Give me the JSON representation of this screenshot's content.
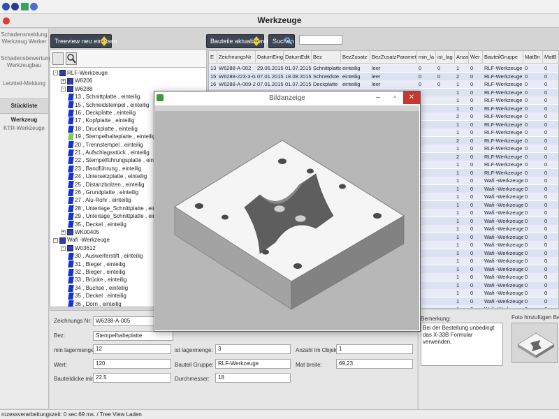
{
  "app": {
    "title": "Werkzeuge"
  },
  "nav": {
    "items": [
      {
        "label": "Schadensmeldung Werkzeug Werker",
        "active": false
      },
      {
        "label": "Schadensbewertung Werkzeugbau",
        "active": false
      },
      {
        "label": "Letztteil-Meldung",
        "active": false
      },
      {
        "label": "Stückliste Werkzeug",
        "active": true
      },
      {
        "label": "KTR-Werkzeuge",
        "active": false
      }
    ]
  },
  "toolbar": {
    "treeview_button": "Treeview neu einlesen",
    "update_parts_button": "Bauteile aktualisieren",
    "search_button": "Suchen",
    "search_value": ""
  },
  "tree": {
    "rows": [
      {
        "level": 0,
        "type": "folder",
        "toggle": "-",
        "label": "RLF-Werkzeuge"
      },
      {
        "level": 1,
        "type": "folder",
        "toggle": "+",
        "label": "W6206"
      },
      {
        "level": 1,
        "type": "folder",
        "toggle": "-",
        "label": "W6288"
      },
      {
        "level": 2,
        "type": "part",
        "label": "13 , Schnittplatte , einteilig"
      },
      {
        "level": 2,
        "type": "part",
        "label": "15 , Schneidstempel , einteilig"
      },
      {
        "level": 2,
        "type": "part",
        "label": "16 , Deckplatte , einteilig"
      },
      {
        "level": 2,
        "type": "part",
        "label": "17 , Kopfplatte , einteilig"
      },
      {
        "level": 2,
        "type": "part",
        "label": "18 , Druckplatte , einteilig"
      },
      {
        "level": 2,
        "type": "part-green",
        "label": "19 , Stempelhalteplatte , einteilig"
      },
      {
        "level": 2,
        "type": "part",
        "label": "20 , Trennstempel , einteilig"
      },
      {
        "level": 2,
        "type": "part",
        "label": "21 , Aufschlagsstück , einteilig"
      },
      {
        "level": 2,
        "type": "part",
        "label": "22 , Stempelführungsplatte , einteilig"
      },
      {
        "level": 2,
        "type": "part",
        "label": "23 , Bandführung , einteilig"
      },
      {
        "level": 2,
        "type": "part",
        "label": "24 , Untersetzplatte , einteilig"
      },
      {
        "level": 2,
        "type": "part",
        "label": "25 , Distanzbolzen , einteilig"
      },
      {
        "level": 2,
        "type": "part",
        "label": "26 , Grundplatte , einteilig"
      },
      {
        "level": 2,
        "type": "part",
        "label": "27 , Alu-Rohr , einteilig"
      },
      {
        "level": 2,
        "type": "part",
        "label": "28 , Unterlage_Schnittplatte , einteilig"
      },
      {
        "level": 2,
        "type": "part",
        "label": "29 , Unterlage_Schnittplatte , einteilig"
      },
      {
        "level": 2,
        "type": "part",
        "label": "35 , Deckel , einteilig"
      },
      {
        "level": 1,
        "type": "folder",
        "toggle": "+",
        "label": "WK00405"
      },
      {
        "level": 0,
        "type": "folder",
        "toggle": "-",
        "label": "Wafi -Werkzeuge"
      },
      {
        "level": 1,
        "type": "folder",
        "toggle": "-",
        "label": "W03612"
      },
      {
        "level": 2,
        "type": "part",
        "label": "30 , Auswerferstift , einteilig"
      },
      {
        "level": 2,
        "type": "part",
        "label": "31 , Bieger , einteilig"
      },
      {
        "level": 2,
        "type": "part",
        "label": "32 , Bieger , einteilig"
      },
      {
        "level": 2,
        "type": "part",
        "label": "33 , Brücke , einteilig"
      },
      {
        "level": 2,
        "type": "part",
        "label": "34 , Buchse , einteilig"
      },
      {
        "level": 2,
        "type": "part",
        "label": "35 , Deckel , einteilig"
      },
      {
        "level": 2,
        "type": "part",
        "label": "36 , Dorn , einteilig"
      }
    ]
  },
  "grid": {
    "columns": [
      "E",
      "ZeichnungsNr",
      "DatumEing",
      "DatumEdit",
      "Bez",
      "BezZusatz",
      "BezZusatzParameter1",
      "min_la",
      "ist_lag",
      "Anzah",
      "Wer",
      "BauteilGruppe",
      "MatBn",
      "MatB"
    ],
    "rows": [
      [
        "13",
        "W6288-A-002",
        "29.06.2015",
        "01.07.2015",
        "Schnittplatte",
        "einteilig",
        "leer",
        "0",
        "0",
        "1",
        "0",
        "RLF-Werkzeuge",
        "0",
        "0"
      ],
      [
        "15",
        "W6288-223-3-04...",
        "07.01.2015",
        "18.08.2015",
        "Schneidste...",
        "einteilig",
        "leer",
        "0",
        "0",
        "2",
        "0",
        "RLF-Werkzeuge",
        "0",
        "0"
      ],
      [
        "16",
        "W6288-A-009-2",
        "07.01.2015",
        "01.07.2015",
        "Deckplatte",
        "einteilig",
        "leer",
        "0",
        "0",
        "1",
        "0",
        "RLF-Werkzeuge",
        "0",
        "0"
      ],
      [
        "",
        "",
        "",
        "",
        "",
        "",
        "",
        "",
        "",
        "1",
        "0",
        "RLF-Werkzeuge",
        "0",
        "0"
      ],
      [
        "",
        "",
        "",
        "",
        "",
        "",
        "",
        "",
        "",
        "1",
        "0",
        "RLF-Werkzeuge",
        "0",
        "0"
      ],
      [
        "",
        "",
        "",
        "",
        "",
        "",
        "",
        "",
        "",
        "1",
        "0",
        "RLF-Werkzeuge",
        "0",
        "0"
      ],
      [
        "",
        "",
        "",
        "",
        "",
        "",
        "",
        "",
        "",
        "2",
        "0",
        "RLF-Werkzeuge",
        "0",
        "0"
      ],
      [
        "",
        "",
        "",
        "",
        "",
        "",
        "",
        "",
        "",
        "1",
        "0",
        "RLF-Werkzeuge",
        "0",
        "0"
      ],
      [
        "",
        "",
        "",
        "",
        "",
        "",
        "",
        "",
        "",
        "1",
        "0",
        "RLF-Werkzeuge",
        "0",
        "0"
      ],
      [
        "",
        "",
        "",
        "",
        "",
        "",
        "",
        "",
        "",
        "2",
        "0",
        "RLF-Werkzeuge",
        "0",
        "0"
      ],
      [
        "",
        "",
        "",
        "",
        "",
        "",
        "",
        "",
        "",
        "1",
        "0",
        "RLF-Werkzeuge",
        "0",
        "0"
      ],
      [
        "",
        "",
        "",
        "",
        "",
        "",
        "",
        "",
        "",
        "2",
        "0",
        "RLF-Werkzeuge",
        "0",
        "0"
      ],
      [
        "",
        "",
        "",
        "",
        "",
        "",
        "",
        "",
        "",
        "1",
        "0",
        "RLF-Werkzeuge",
        "0",
        "0"
      ],
      [
        "",
        "",
        "",
        "",
        "",
        "",
        "",
        "",
        "",
        "1",
        "0",
        "RLF-Werkzeuge",
        "0",
        "0"
      ],
      [
        "",
        "",
        "",
        "",
        "",
        "",
        "",
        "",
        "",
        "1",
        "0",
        "Wafi -Werkzeuge",
        "0",
        "0"
      ],
      [
        "",
        "",
        "",
        "",
        "",
        "",
        "",
        "",
        "",
        "1",
        "0",
        "Wafi -Werkzeuge",
        "0",
        "0"
      ],
      [
        "",
        "",
        "",
        "",
        "",
        "",
        "",
        "",
        "",
        "1",
        "0",
        "Wafi -Werkzeuge",
        "0",
        "0"
      ],
      [
        "",
        "",
        "",
        "",
        "",
        "",
        "",
        "",
        "",
        "1",
        "0",
        "Wafi -Werkzeuge",
        "0",
        "0"
      ],
      [
        "",
        "",
        "",
        "",
        "",
        "",
        "",
        "",
        "",
        "1",
        "0",
        "Wafi -Werkzeuge",
        "0",
        "0"
      ],
      [
        "",
        "",
        "",
        "",
        "",
        "",
        "",
        "",
        "",
        "1",
        "0",
        "Wafi -Werkzeuge",
        "0",
        "0"
      ],
      [
        "",
        "",
        "",
        "",
        "",
        "",
        "",
        "",
        "",
        "1",
        "0",
        "Wafi -Werkzeuge",
        "0",
        "0"
      ],
      [
        "",
        "",
        "",
        "",
        "",
        "",
        "",
        "",
        "",
        "1",
        "0",
        "Wafi -Werkzeuge",
        "0",
        "0"
      ],
      [
        "",
        "",
        "",
        "",
        "",
        "",
        "",
        "",
        "",
        "1",
        "0",
        "Wafi -Werkzeuge",
        "0",
        "0"
      ],
      [
        "",
        "",
        "",
        "",
        "",
        "",
        "",
        "",
        "",
        "1",
        "0",
        "Wafi -Werkzeuge",
        "0",
        "0"
      ],
      [
        "",
        "",
        "",
        "",
        "",
        "",
        "",
        "",
        "",
        "1",
        "0",
        "Wafi -Werkzeuge",
        "0",
        "0"
      ],
      [
        "",
        "",
        "",
        "",
        "",
        "",
        "",
        "",
        "",
        "1",
        "0",
        "Wafi -Werkzeuge",
        "0",
        "0"
      ],
      [
        "",
        "",
        "",
        "",
        "",
        "",
        "",
        "",
        "",
        "1",
        "0",
        "Wafi -Werkzeuge",
        "0",
        "0"
      ],
      [
        "",
        "",
        "",
        "",
        "",
        "",
        "",
        "",
        "",
        "1",
        "0",
        "Wafi -Werkzeuge",
        "0",
        "0"
      ],
      [
        "",
        "",
        "",
        "",
        "",
        "",
        "",
        "",
        "",
        "1",
        "0",
        "Wafi -Werkzeuge",
        "0",
        "0"
      ],
      [
        "",
        "",
        "",
        "",
        "",
        "",
        "",
        "",
        "",
        "1",
        "0",
        "Wafi -Werkzeuge",
        "0",
        "0"
      ],
      [
        "",
        "",
        "",
        "",
        "",
        "",
        "",
        "",
        "",
        "1",
        "0",
        "Wafi -Werkzeuge",
        "0",
        "0"
      ],
      [
        "",
        "",
        "",
        "",
        "",
        "",
        "",
        "",
        "",
        "1",
        "0",
        "Wafi -Werkzeuge",
        "0",
        "0"
      ]
    ]
  },
  "form": {
    "drawing_no_label": "Zeichnungs Nr:",
    "drawing_no": "W6288-A-005",
    "desc_label": "Bez:",
    "desc": "Stempelhalteplatte",
    "min_stock_label": "min lagermenge:",
    "min_stock": "12",
    "stock_label": "ist lagermenge:",
    "stock": "3",
    "count_label": "Anzahl Im Objekt:",
    "count": "1",
    "value_label": "Wert:",
    "value": "120",
    "group_label": "Bauteil Gruppe:",
    "group": "RLF-Werkzeuge",
    "mat_width_label": "Mat breite:",
    "mat_width": "69,23",
    "thickness_label": "Bauteildicke min:",
    "thickness": "22.5",
    "diameter_label": "Durchmesser:",
    "diameter": "18"
  },
  "remarks": {
    "label": "Bemerkung:",
    "text": "Bei der Bestellung unbedingt das X-33B Formular verwenden.",
    "photo_label": "Foto hinzufügen Bauteile"
  },
  "status": {
    "text": "rozessverarbeitungszeit: 0 sec.69 ms. / Tree View Laden"
  },
  "modal": {
    "title": "Bildanzeige"
  }
}
